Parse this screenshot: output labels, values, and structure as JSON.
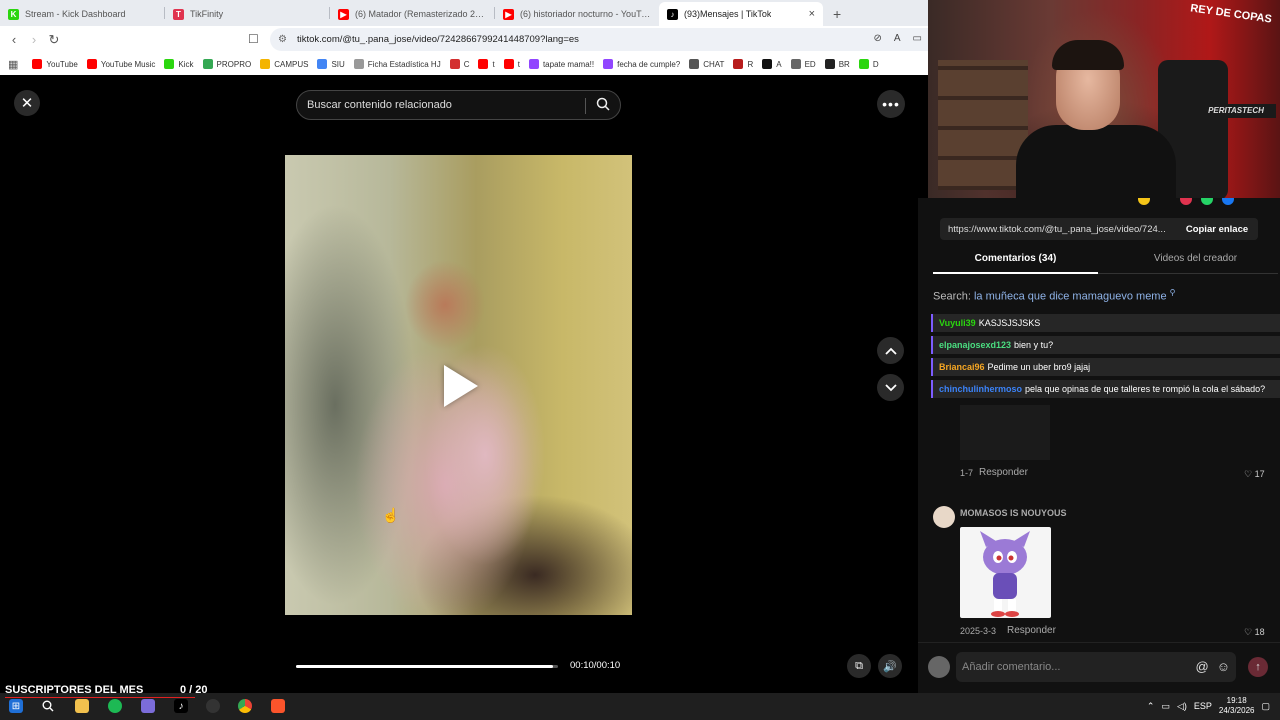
{
  "tabs": [
    {
      "title": "Stream - Kick Dashboard",
      "icon": "kick-icon",
      "color": "#2bd60f",
      "glyph": "K"
    },
    {
      "title": "TikFinity",
      "icon": "tikfinity-icon",
      "color": "#e0334f",
      "glyph": "T"
    },
    {
      "title": "(6) Matador (Remasterizado 2008) -",
      "icon": "youtube-icon",
      "color": "#ff0000",
      "glyph": "▶"
    },
    {
      "title": "(6) historiador nocturno - YouTube",
      "icon": "youtube-icon",
      "color": "#ff0000",
      "glyph": "▶"
    },
    {
      "title": "(93)Mensajes | TikTok",
      "icon": "tiktok-icon",
      "color": "#000000",
      "glyph": "♪"
    }
  ],
  "tab_close": "×",
  "new_tab": "+",
  "address": {
    "url": "tiktok.com/@tu_.pana_jose/video/7242866799241448709?lang=es"
  },
  "bookmarks": [
    {
      "label": "YouTube",
      "color": "#ff0000"
    },
    {
      "label": "YouTube Music",
      "color": "#ff0000"
    },
    {
      "label": "Kick",
      "color": "#2bd60f"
    },
    {
      "label": "PROPRO",
      "color": "#34a853"
    },
    {
      "label": "CAMPUS",
      "color": "#f4b400"
    },
    {
      "label": "SIU",
      "color": "#4285f4"
    },
    {
      "label": "Ficha Estadística HJ",
      "color": "#999999"
    },
    {
      "label": "C",
      "color": "#d32f2f"
    },
    {
      "label": "t",
      "color": "#ff0000"
    },
    {
      "label": "t",
      "color": "#ff0000"
    },
    {
      "label": "tapate mama!!",
      "color": "#9146ff"
    },
    {
      "label": "fecha de cumple?",
      "color": "#9146ff"
    },
    {
      "label": "CHAT",
      "color": "#555555"
    },
    {
      "label": "R",
      "color": "#b71c1c"
    },
    {
      "label": "A",
      "color": "#111111"
    },
    {
      "label": "ED",
      "color": "#666666"
    },
    {
      "label": "BR",
      "color": "#222222"
    },
    {
      "label": "D",
      "color": "#2bd60f"
    }
  ],
  "tiktok": {
    "search_placeholder": "Buscar contenido relacionado",
    "time": "00:10/00:10",
    "progress": 0.98,
    "copy_link_url": "https://www.tiktok.com/@tu_.pana_jose/video/724...",
    "copy_link_label": "Copiar enlace",
    "tab_comments": "Comentarios (34)",
    "tab_videos": "Videos del creador",
    "search_prefix": "Search:",
    "search_query": "la muñeca que dice mamaguevo meme",
    "add_comment_placeholder": "Añadir comentario...",
    "comments": [
      {
        "meta": "1-7",
        "reply": "Responder",
        "likes": "17"
      },
      {
        "author": "MOMASOS IS NOUYOUS",
        "meta": "2025-3-3",
        "reply": "Responder",
        "likes": "18"
      }
    ]
  },
  "chat": [
    {
      "user": "Vuyuli39",
      "color": "#2bd60f",
      "text": "KASJSJSJSKS"
    },
    {
      "user": "elpanajosexd123",
      "color": "#4ade80",
      "text": "bien y tu?"
    },
    {
      "user": "Briancai96",
      "color": "#f5a623",
      "text": "Pedime un uber bro9 jajaj"
    },
    {
      "user": "chinchulinhermoso",
      "color": "#3b82f6",
      "text": "pela que opinas de que talleres te rompió la cola el sábado?"
    }
  ],
  "webcam": {
    "poster": "REY DE COPAS",
    "poster_sub": "PERITASTECH"
  },
  "overlay": {
    "subs_label": "SUSCRIPTORES DEL MES",
    "subs_count": "0  / 20"
  },
  "taskbar": {
    "lang": "ESP",
    "time": "19:18",
    "date": "24/3/2026"
  }
}
